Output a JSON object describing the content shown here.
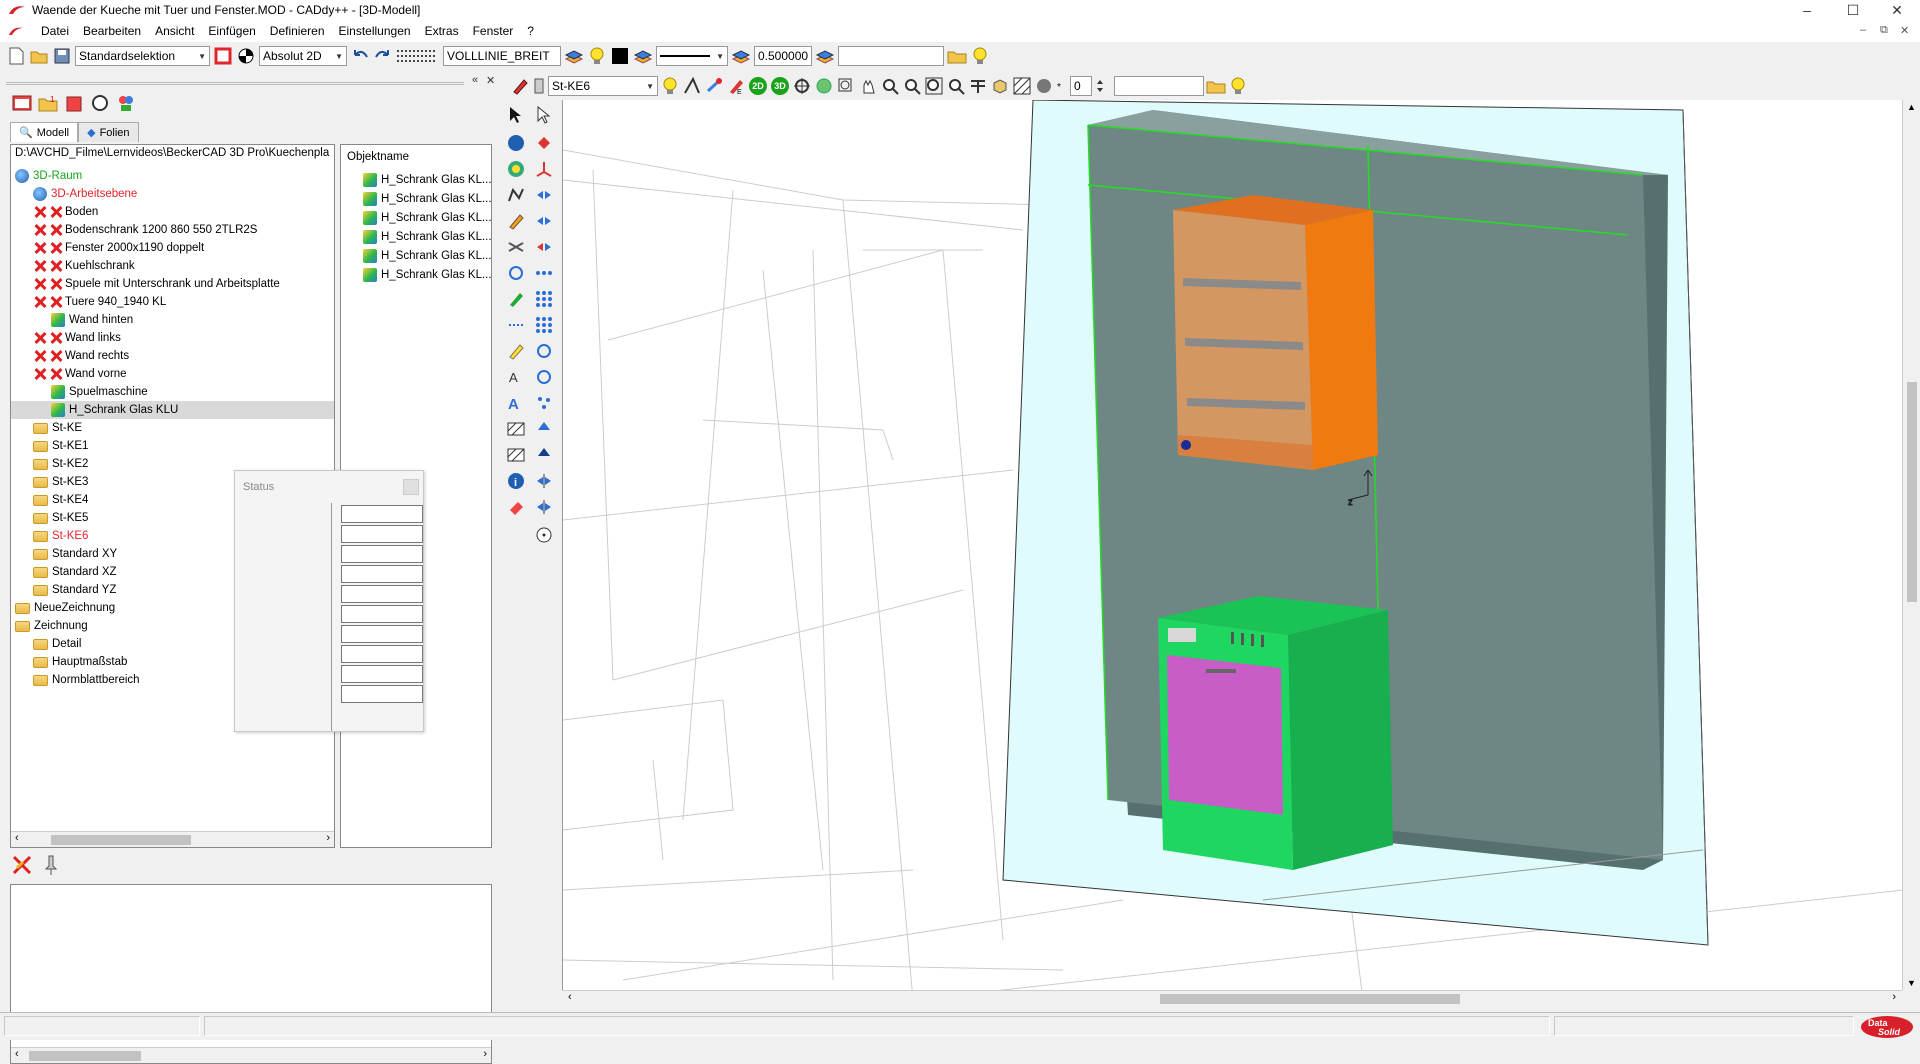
{
  "window": {
    "title": "Waende der Kueche mit Tuer und Fenster.MOD  -  CADdy++ - [3D-Modell]",
    "controls": [
      "–",
      "☐",
      "✕"
    ]
  },
  "menu": {
    "items": [
      "Datei",
      "Bearbeiten",
      "Ansicht",
      "Einfügen",
      "Definieren",
      "Einstellungen",
      "Extras",
      "Fenster",
      "?"
    ],
    "mdi_controls": [
      "–",
      "⧉",
      "✕"
    ]
  },
  "toolbar1": {
    "selection_mode": "Standardselektion",
    "coord_mode": "Absolut 2D",
    "line_type": "VOLLLINIE_BREIT",
    "line_width": "0.500000",
    "extra_field": ""
  },
  "toolbar2": {
    "layer": "St-KE6",
    "view_2d": "2D",
    "view_3d": "3D",
    "counter": "0",
    "extra_field": ""
  },
  "panel": {
    "close_glyphs": [
      "«",
      "✕"
    ],
    "tabs": [
      {
        "label": "Modell",
        "active": true
      },
      {
        "label": "Folien",
        "active": false
      }
    ],
    "path": "D:\\AVCHD_Filme\\Lernvideos\\BeckerCAD 3D Pro\\Kuechenpla",
    "tree": [
      {
        "label": "3D-Raum",
        "level": 0,
        "icon": "globe",
        "color": "green"
      },
      {
        "label": "3D-Arbeitsebene",
        "level": 1,
        "icon": "globe",
        "color": "red"
      },
      {
        "label": "Boden",
        "level": 1,
        "icon": "hidden-x",
        "color": "normal"
      },
      {
        "label": "Bodenschrank 1200 860 550 2TLR2S",
        "level": 1,
        "icon": "hidden-x",
        "color": "normal"
      },
      {
        "label": "Fenster 2000x1190 doppelt",
        "level": 1,
        "icon": "hidden-x",
        "color": "normal"
      },
      {
        "label": "Kuehlschrank",
        "level": 1,
        "icon": "hidden-x",
        "color": "normal"
      },
      {
        "label": "Spuele mit Unterschrank und Arbeitsplatte",
        "level": 1,
        "icon": "hidden-x",
        "color": "normal"
      },
      {
        "label": "Tuere 940_1940 KL",
        "level": 1,
        "icon": "hidden-x",
        "color": "normal"
      },
      {
        "label": "Wand hinten",
        "level": 2,
        "icon": "cube",
        "color": "normal"
      },
      {
        "label": "Wand links",
        "level": 1,
        "icon": "hidden-x",
        "color": "normal"
      },
      {
        "label": "Wand rechts",
        "level": 1,
        "icon": "hidden-x",
        "color": "normal"
      },
      {
        "label": "Wand vorne",
        "level": 1,
        "icon": "hidden-x",
        "color": "normal"
      },
      {
        "label": "Spuelmaschine",
        "level": 2,
        "icon": "cube",
        "color": "normal"
      },
      {
        "label": "H_Schrank Glas KLU",
        "level": 2,
        "icon": "cube",
        "color": "normal",
        "selected": true
      },
      {
        "label": "St-KE",
        "level": 1,
        "icon": "folder",
        "color": "normal"
      },
      {
        "label": "St-KE1",
        "level": 1,
        "icon": "folder",
        "color": "normal"
      },
      {
        "label": "St-KE2",
        "level": 1,
        "icon": "folder",
        "color": "normal"
      },
      {
        "label": "St-KE3",
        "level": 1,
        "icon": "folder",
        "color": "normal"
      },
      {
        "label": "St-KE4",
        "level": 1,
        "icon": "folder",
        "color": "normal"
      },
      {
        "label": "St-KE5",
        "level": 1,
        "icon": "folder",
        "color": "normal"
      },
      {
        "label": "St-KE6",
        "level": 1,
        "icon": "folder",
        "color": "red"
      },
      {
        "label": "Standard XY",
        "level": 1,
        "icon": "folder",
        "color": "normal"
      },
      {
        "label": "Standard XZ",
        "level": 1,
        "icon": "folder",
        "color": "normal"
      },
      {
        "label": "Standard YZ",
        "level": 1,
        "icon": "folder",
        "color": "normal"
      },
      {
        "label": "NeueZeichnung",
        "level": 0,
        "icon": "folder",
        "color": "normal"
      },
      {
        "label": "Zeichnung",
        "level": 0,
        "icon": "folder",
        "color": "normal"
      },
      {
        "label": "Detail",
        "level": 1,
        "icon": "folder",
        "color": "normal"
      },
      {
        "label": "Hauptmaßstab",
        "level": 1,
        "icon": "folder",
        "color": "normal"
      },
      {
        "label": "Normblattbereich",
        "level": 1,
        "icon": "folder",
        "color": "normal"
      }
    ],
    "object_list": {
      "header": "Objektname",
      "items": [
        "H_Schrank Glas KL...",
        "H_Schrank Glas KL...",
        "H_Schrank Glas KL...",
        "H_Schrank Glas KL...",
        "H_Schrank Glas KL...",
        "H_Schrank Glas KL..."
      ]
    },
    "status_dialog": {
      "title": "Status",
      "field_count": 10
    }
  },
  "colors": {
    "wall": "#6e8785",
    "wall_plane": "#dffbfb",
    "cabinet_orange": "#f07a10",
    "shelf": "#8a8a8a",
    "dishwasher_green": "#1ed660",
    "dishwasher_door": "#c85dc8",
    "selection_green": "#22dd22",
    "accent_red": "#e0262c"
  },
  "scroll_arrows": [
    "‹",
    "›",
    "▲",
    "▼"
  ]
}
